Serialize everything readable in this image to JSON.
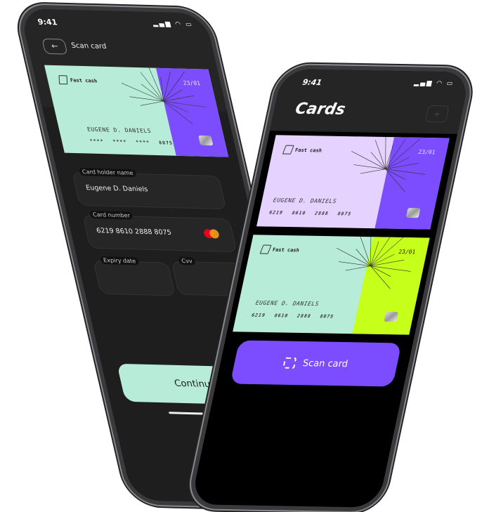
{
  "scan_phone": {
    "status_time": "9:41",
    "status_icons": "▂▄▆ ◠ ▭",
    "back_icon": "←",
    "title": "Scan card",
    "card": {
      "brand": "Fast cash",
      "expiry": "23/01",
      "holder": "EUGENE D. DANIELS",
      "number": "**** **** **** 8075",
      "colors": {
        "body": "#b7ecd8",
        "band": "#7c4dff"
      }
    },
    "fields": {
      "holder": {
        "label": "Card holder name",
        "value": "Eugene D. Daniels"
      },
      "number": {
        "label": "Card number",
        "value": "6219  8610  2888  8075"
      },
      "expiry": {
        "label": "Expiry date",
        "value": ""
      },
      "cvv": {
        "label": "Cvv",
        "value": ""
      }
    },
    "continue_label": "Continue"
  },
  "cards_phone": {
    "status_time": "9:41",
    "status_icons": "▂▄▆ ◠ ▭",
    "title": "Cards",
    "add_icon": "+",
    "cards": [
      {
        "brand": "Fast cash",
        "expiry": "23/01",
        "holder": "EUGENE D. DANIELS",
        "number": "6219 8610 2888 8075",
        "colors": {
          "body": "#e6d2ff",
          "band": "#7c4dff",
          "expiry_text": "#e8e0ff"
        }
      },
      {
        "brand": "Fast cash",
        "expiry": "23/01",
        "holder": "EUGENE D. DANIELS",
        "number": "6219 8610 2888 8075",
        "colors": {
          "body": "#b7ecd8",
          "band": "#c6ff1a",
          "expiry_text": "#222222"
        }
      }
    ],
    "scan_label": "Scan card"
  }
}
